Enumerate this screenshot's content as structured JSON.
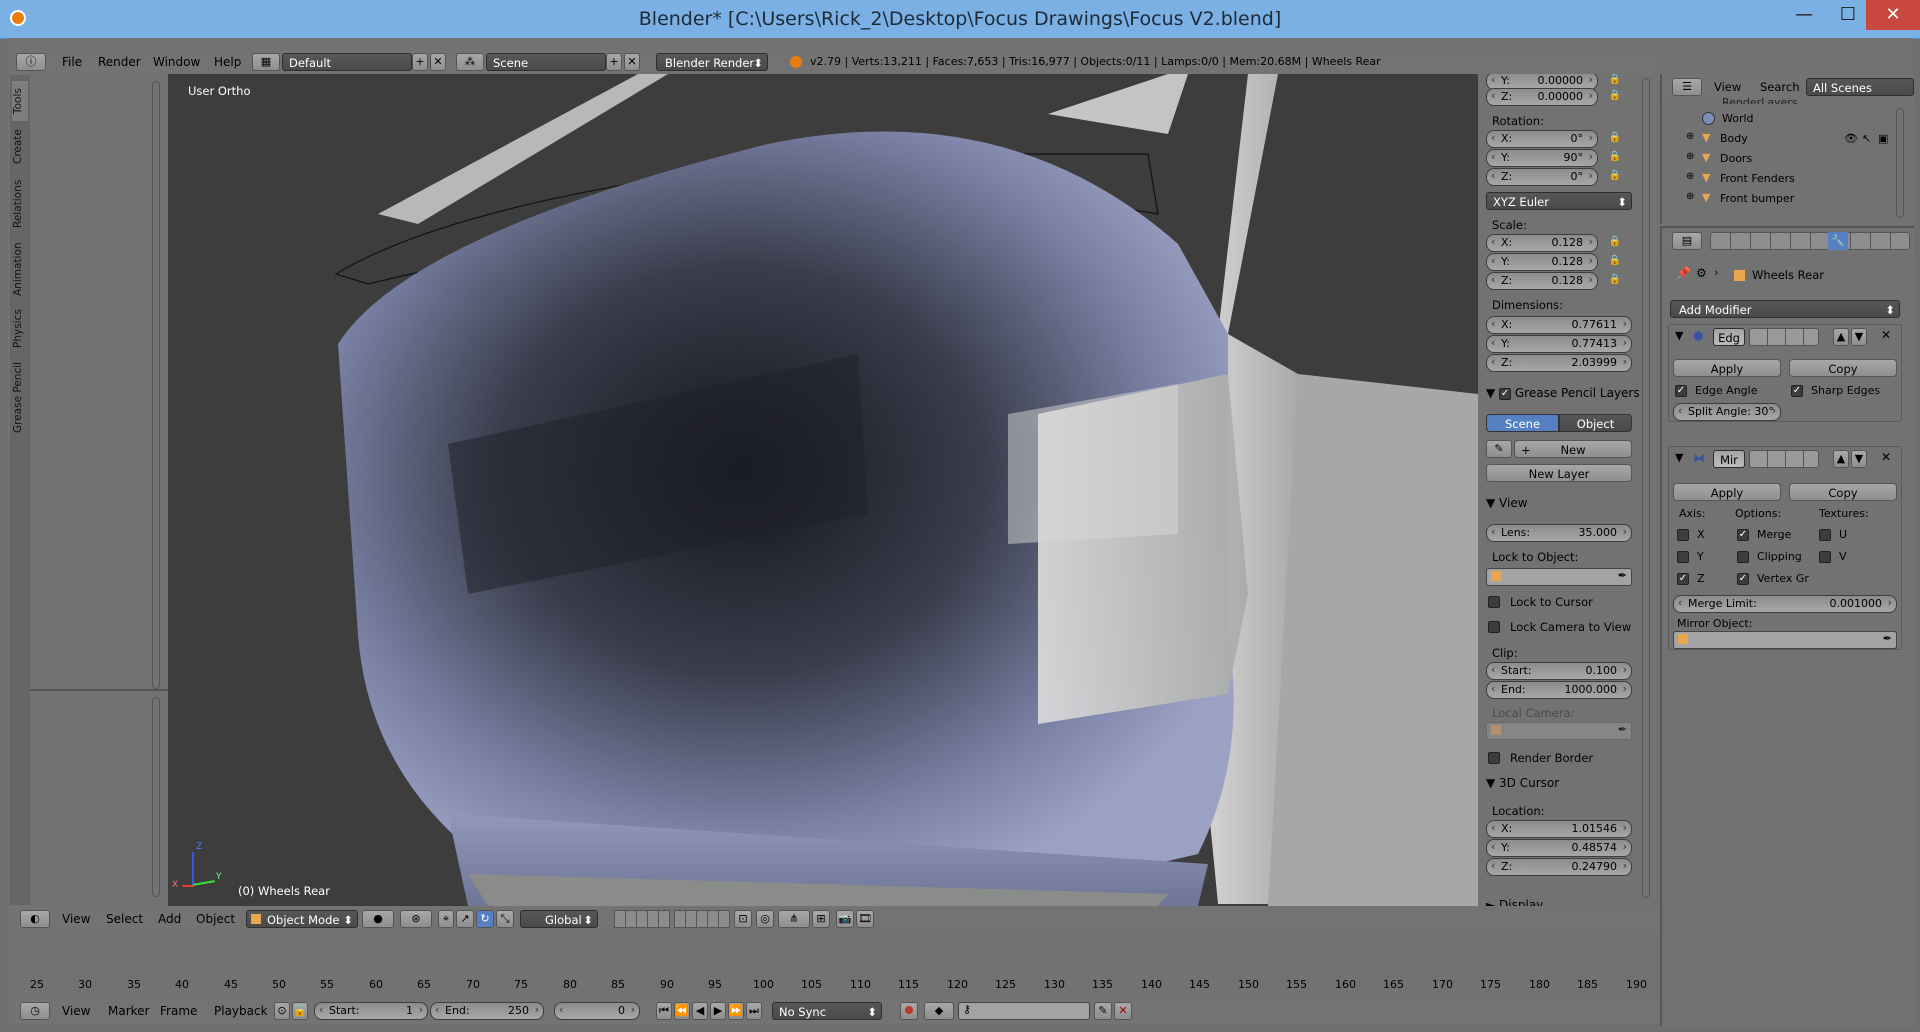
{
  "window": {
    "title": "Blender* [C:\\Users\\Rick_2\\Desktop\\Focus Drawings\\Focus V2.blend]",
    "minimize": "—",
    "maximize": "☐",
    "close": "✕"
  },
  "info_header": {
    "menus": [
      "File",
      "Render",
      "Window",
      "Help"
    ],
    "layout": "Default",
    "scene": "Scene",
    "engine": "Blender Render",
    "stats": "v2.79 | Verts:13,211 | Faces:7,653 | Tris:16,977 | Objects:0/11 | Lamps:0/0 | Mem:20.68M | Wheels Rear"
  },
  "tool_tabs": [
    "Tools",
    "Create",
    "Relations",
    "Animation",
    "Physics",
    "Grease Pencil"
  ],
  "viewport": {
    "label": "User Ortho",
    "object_label": "(0) Wheels Rear",
    "axis_x": "X",
    "axis_y": "Y",
    "axis_z": "Z"
  },
  "view3d_header": {
    "menus": [
      "View",
      "Select",
      "Add",
      "Object"
    ],
    "mode": "Object Mode",
    "orientation": "Global"
  },
  "n_panel": {
    "loc_y": {
      "l": "Y:",
      "v": "0.00000"
    },
    "loc_z": {
      "l": "Z:",
      "v": "0.00000"
    },
    "rotation_label": "Rotation:",
    "rot": [
      {
        "l": "X:",
        "v": "0°"
      },
      {
        "l": "Y:",
        "v": "90°"
      },
      {
        "l": "Z:",
        "v": "0°"
      }
    ],
    "rot_mode": "XYZ Euler",
    "scale_label": "Scale:",
    "scale": [
      {
        "l": "X:",
        "v": "0.128"
      },
      {
        "l": "Y:",
        "v": "0.128"
      },
      {
        "l": "Z:",
        "v": "0.128"
      }
    ],
    "dim_label": "Dimensions:",
    "dim": [
      {
        "l": "X:",
        "v": "0.77611"
      },
      {
        "l": "Y:",
        "v": "0.77413"
      },
      {
        "l": "Z:",
        "v": "2.03999"
      }
    ],
    "gp_title": "Grease Pencil Layers",
    "gp_scene": "Scene",
    "gp_object": "Object",
    "gp_new": "New",
    "gp_new_layer": "New Layer",
    "view_title": "View",
    "lens": {
      "l": "Lens:",
      "v": "35.000"
    },
    "lock_obj": "Lock to Object:",
    "lock_cursor": "Lock to Cursor",
    "lock_cam": "Lock Camera to View",
    "clip": "Clip:",
    "clip_start": {
      "l": "Start:",
      "v": "0.100"
    },
    "clip_end": {
      "l": "End:",
      "v": "1000.000"
    },
    "local_cam": "Local Camera:",
    "render_border": "Render Border",
    "cursor_title": "3D Cursor",
    "location": "Location:",
    "cur": [
      {
        "l": "X:",
        "v": "1.01546"
      },
      {
        "l": "Y:",
        "v": "0.48574"
      },
      {
        "l": "Z:",
        "v": "0.24790"
      }
    ],
    "display": "Display"
  },
  "outliner": {
    "view": "View",
    "search": "Search",
    "scenes": "All Scenes",
    "cut_top": "RenderLayers",
    "items": [
      "World",
      "Body",
      "Doors",
      "Front Fenders",
      "Front bumper"
    ]
  },
  "properties": {
    "object": "Wheels Rear",
    "add_modifier": "Add Modifier",
    "mod1": {
      "name": "Edg",
      "apply": "Apply",
      "copy": "Copy",
      "edge_angle": "Edge Angle",
      "sharp_edges": "Sharp Edges",
      "split_angle": "Split Angle: 30°"
    },
    "mod2": {
      "name": "Mir",
      "apply": "Apply",
      "copy": "Copy",
      "axis": "Axis:",
      "options": "Options:",
      "textures": "Textures:",
      "x": "X",
      "y": "Y",
      "z": "Z",
      "merge": "Merge",
      "clipping": "Clipping",
      "vertex": "Vertex Gr",
      "u": "U",
      "v": "V",
      "merge_limit": {
        "l": "Merge Limit:",
        "v": "0.001000"
      },
      "mirror_object": "Mirror Object:"
    }
  },
  "timeline": {
    "ticks": [
      "25",
      "30",
      "35",
      "40",
      "45",
      "50",
      "55",
      "60",
      "65",
      "70",
      "75",
      "80",
      "85",
      "90",
      "95",
      "100",
      "105",
      "110",
      "115",
      "120",
      "125",
      "130",
      "135",
      "140",
      "145",
      "150",
      "155",
      "160",
      "165",
      "170",
      "175",
      "180",
      "185",
      "190"
    ],
    "menus": [
      "View",
      "Marker",
      "Frame",
      "Playback"
    ],
    "start": {
      "l": "Start:",
      "v": "1"
    },
    "end": {
      "l": "End:",
      "v": "250"
    },
    "current": "0",
    "sync": "No Sync"
  }
}
